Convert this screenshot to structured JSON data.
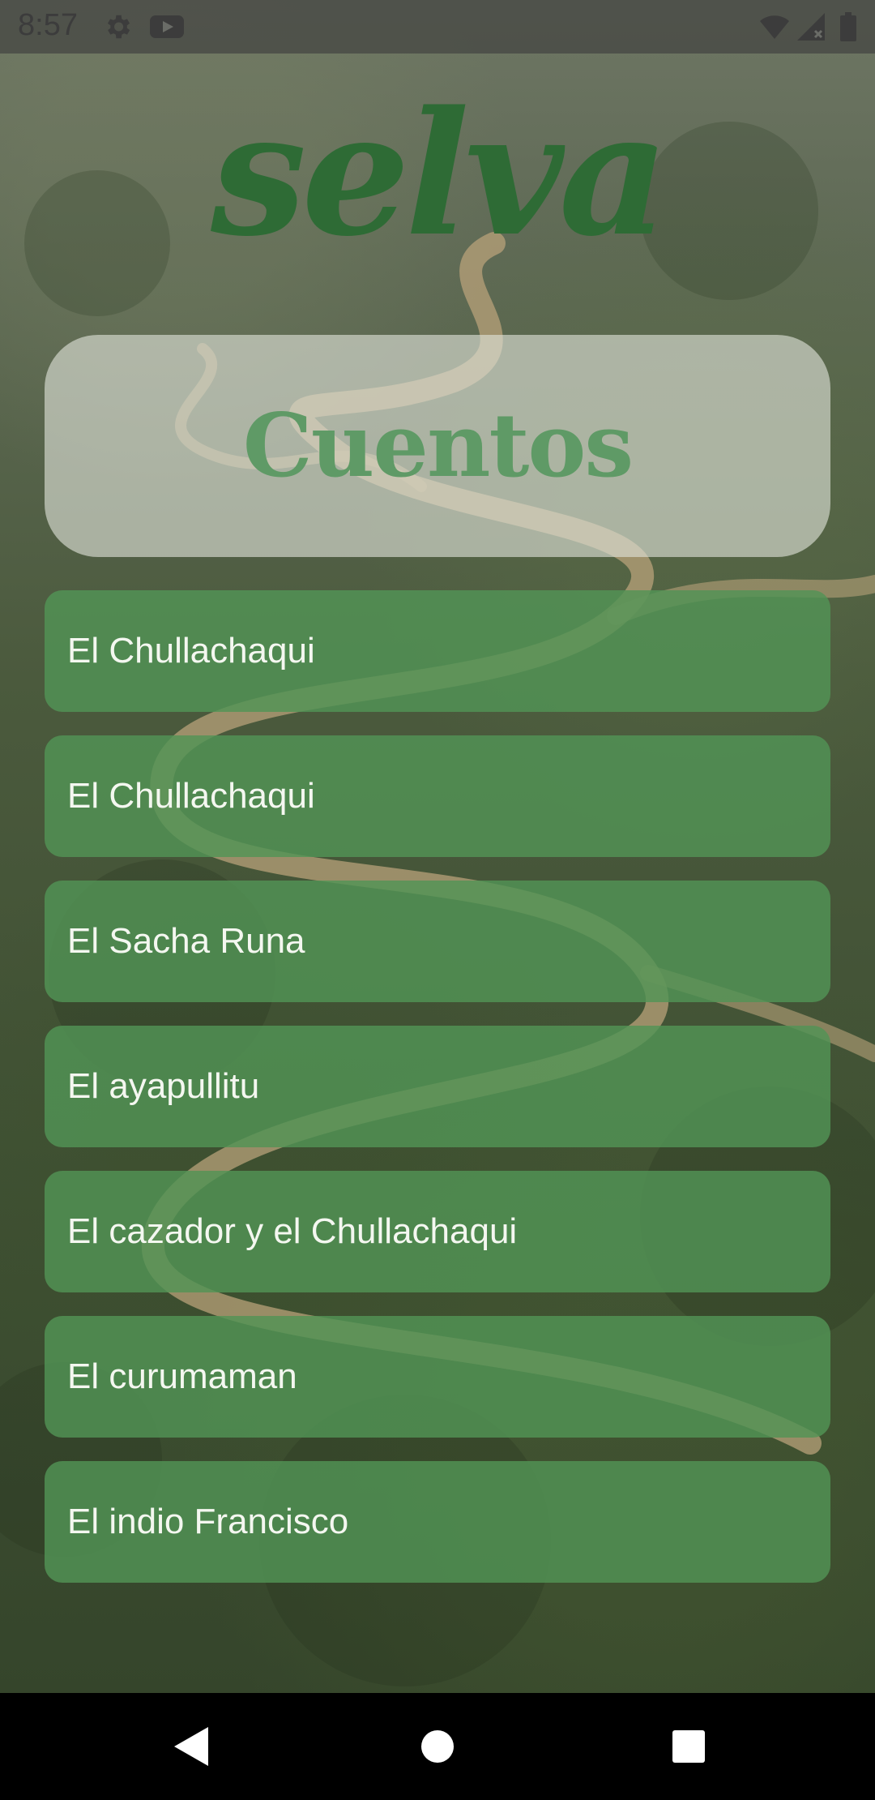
{
  "status_bar": {
    "time": "8:57",
    "icons": [
      "gear-icon",
      "youtube-icon",
      "wifi-icon",
      "signal-icon",
      "battery-icon"
    ]
  },
  "app": {
    "logo": "selva"
  },
  "header": {
    "title": "Cuentos"
  },
  "stories": [
    {
      "label": "El Chullachaqui"
    },
    {
      "label": "El Chullachaqui"
    },
    {
      "label": "El Sacha Runa"
    },
    {
      "label": "El ayapullitu"
    },
    {
      "label": "El cazador y el Chullachaqui"
    },
    {
      "label": "El curumaman"
    },
    {
      "label": "El indio Francisco"
    }
  ],
  "nav_bar": {
    "icons": [
      "back-icon",
      "home-icon",
      "recents-icon"
    ]
  },
  "colors": {
    "logo": "#2e6b35",
    "header_title": "#5f9a66",
    "item_bg": "#529456",
    "item_text": "#f4f7f0"
  }
}
